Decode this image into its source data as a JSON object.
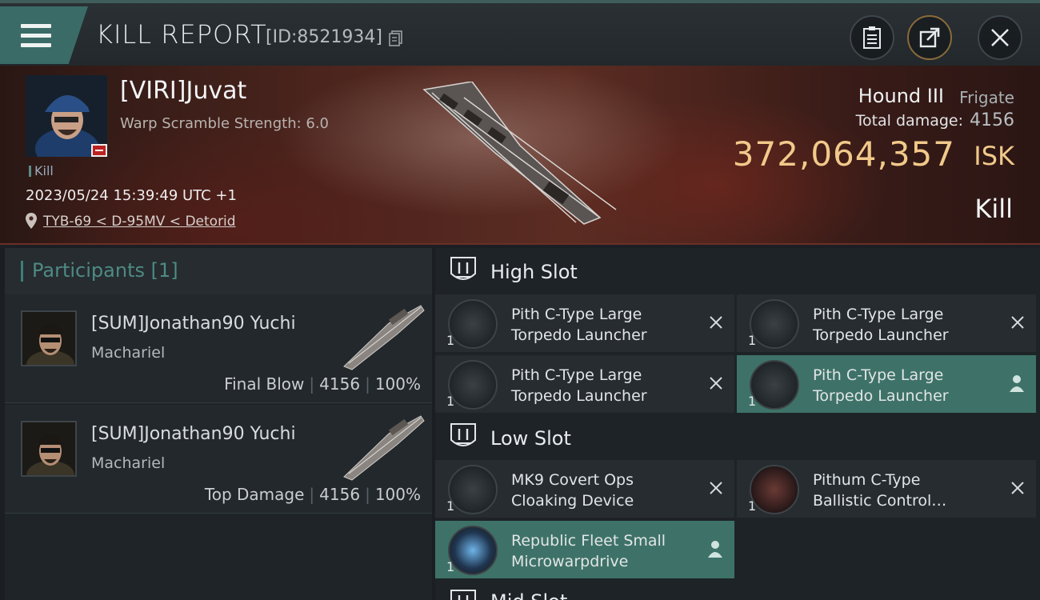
{
  "header": {
    "title": "KILL REPORT",
    "report_id": "[ID:8521934]"
  },
  "victim": {
    "name": "[VIRI]Juvat",
    "scramble": "Warp Scramble Strength: 6.0",
    "kill_tag": "Kill",
    "datetime": "2023/05/24 15:39:49 UTC +1",
    "location": "TYB-69 < D-95MV < Detorid",
    "ship_name": "Hound III",
    "ship_class": "Frigate",
    "total_damage_label": "Total damage:",
    "total_damage": "4156",
    "isk_value": "372,064,357",
    "isk_unit": "ISK",
    "result": "Kill"
  },
  "participants": {
    "heading": "Participants [1]",
    "rows": [
      {
        "name": "[SUM]Jonathan90 Yuchi",
        "ship": "Machariel",
        "tag": "Final Blow",
        "damage": "4156",
        "percent": "100%"
      },
      {
        "name": "[SUM]Jonathan90 Yuchi",
        "ship": "Machariel",
        "tag": "Top Damage",
        "damage": "4156",
        "percent": "100%"
      }
    ]
  },
  "slots": {
    "high": {
      "label": "High Slot",
      "modules": [
        {
          "line1": "Pith C-Type Large",
          "line2": "Torpedo Launcher",
          "qty": "1"
        },
        {
          "line1": "Pith C-Type Large",
          "line2": "Torpedo Launcher",
          "qty": "1"
        },
        {
          "line1": "Pith C-Type Large",
          "line2": "Torpedo Launcher",
          "qty": "1"
        },
        {
          "line1": "Pith C-Type Large",
          "line2": "Torpedo Launcher",
          "qty": "1"
        }
      ]
    },
    "low": {
      "label": "Low Slot",
      "modules": [
        {
          "line1": "MK9 Covert Ops",
          "line2": "Cloaking Device",
          "qty": "1"
        },
        {
          "line1": "Pithum C-Type",
          "line2": "Ballistic Control…",
          "qty": "1"
        },
        {
          "line1": "Republic Fleet Small",
          "line2": "Microwarpdrive",
          "qty": "1"
        }
      ]
    },
    "mid": {
      "label": "Mid Slot"
    }
  },
  "colors": {
    "accent": "#3e7268",
    "isk": "#f1c98a",
    "header_tab": "#3b6b66"
  }
}
